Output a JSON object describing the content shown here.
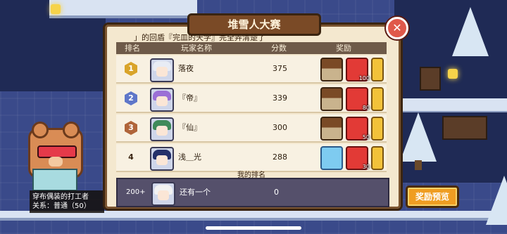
{
  "dialog": {
    "title": "堆雪人大赛",
    "notice": "」的回盾『完皿的天学』完全弄清楚了",
    "headers": {
      "rank": "排名",
      "name": "玩家名称",
      "score": "分数",
      "reward": "奖励"
    }
  },
  "rows": [
    {
      "rank": "1",
      "rank_style": "gold",
      "name": "落夜",
      "score": "375",
      "redpack_count": "100",
      "avatar": "white-hair"
    },
    {
      "rank": "2",
      "rank_style": "silver",
      "name": "『帝』",
      "score": "339",
      "redpack_count": "80",
      "avatar": "purple-hair"
    },
    {
      "rank": "3",
      "rank_style": "bronze",
      "name": "『仙』",
      "score": "300",
      "redpack_count": "50",
      "avatar": "green-hair"
    },
    {
      "rank": "4",
      "rank_style": "plain",
      "name": "浅＿光",
      "score": "288",
      "redpack_count": "30",
      "avatar": "navy-hair"
    }
  ],
  "my_rank": {
    "label": "我的排名",
    "rank": "200+",
    "name": "还有一个",
    "score": "0"
  },
  "preview_button": "奖励预览",
  "npc": {
    "name": "穿布偶装的打工者",
    "relation": "关系：普通（50）"
  },
  "colors": {
    "dialog_bg": "#f4e8cf",
    "header_bg": "#6e5a49",
    "my_row_bg": "#55506b",
    "accent_button": "#ef9d22",
    "close_button": "#e0584a"
  },
  "icons": {
    "close": "close-icon",
    "reward_1": "bed-reward-icon",
    "reward_2": "red-envelope-icon",
    "reward_3": "gold-coin-icon"
  }
}
